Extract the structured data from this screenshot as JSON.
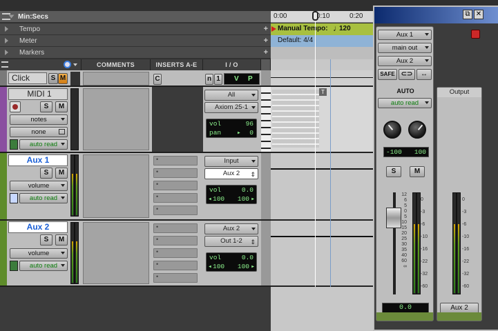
{
  "ruler": {
    "main_label": "Min:Secs",
    "rows": [
      {
        "label": "Tempo"
      },
      {
        "label": "Meter"
      },
      {
        "label": "Markers"
      }
    ],
    "times": [
      "0:00",
      "0:10",
      "0:20"
    ],
    "tempo_marker": "Manual Tempo:",
    "tempo_value": "120",
    "meter_marker": "Default: 4/4"
  },
  "columns": {
    "comments": "COMMENTS",
    "inserts": "INSERTS A-E",
    "io": "I / O"
  },
  "tracks": {
    "click": {
      "name": "Click",
      "solo": "S",
      "mute": "M",
      "insert_c": "C",
      "n": "n",
      "num": "1",
      "v": "V",
      "p": "P"
    },
    "midi1": {
      "name": "MIDI 1",
      "solo": "S",
      "mute": "M",
      "view": "notes",
      "patch": "none",
      "auto": "auto read",
      "input": "All",
      "output": "Axiom 25-1",
      "vol_label": "vol",
      "vol_value": "96",
      "pan_label": "pan",
      "pan_value": "0"
    },
    "aux1": {
      "name": "Aux 1",
      "solo": "S",
      "mute": "M",
      "view": "volume",
      "auto": "auto read",
      "input": "Input",
      "output": "Aux 2",
      "vol_label": "vol",
      "vol_value": "0.0",
      "pan_left": "100",
      "pan_right": "100"
    },
    "aux2": {
      "name": "Aux 2",
      "solo": "S",
      "mute": "M",
      "view": "volume",
      "auto": "auto read",
      "input": "Aux 2",
      "output": "Out 1-2",
      "vol_label": "vol",
      "vol_value": "0.0",
      "pan_left": "100",
      "pan_right": "100"
    }
  },
  "mixer": {
    "restore_icon": "⧉",
    "close_icon": "✕",
    "channel_name": "Aux 1",
    "output_select": "main out",
    "send_select": "Aux 2",
    "safe": "SAFE",
    "auto_label": "AUTO",
    "auto_mode": "auto read",
    "pan_left": "-100",
    "pan_right": "100",
    "solo": "S",
    "mute": "M",
    "fader_value": "0.0",
    "scale": [
      "12",
      "6",
      "5",
      "0",
      "5",
      "10",
      "15",
      "20",
      "25",
      "30",
      "35",
      "40",
      "60",
      "∞"
    ],
    "meter_scale": [
      "0",
      "-3",
      "-6",
      "-10",
      "-16",
      "-22",
      "-32",
      "-60"
    ],
    "output_label": "Output",
    "output_name": "Aux 2"
  }
}
